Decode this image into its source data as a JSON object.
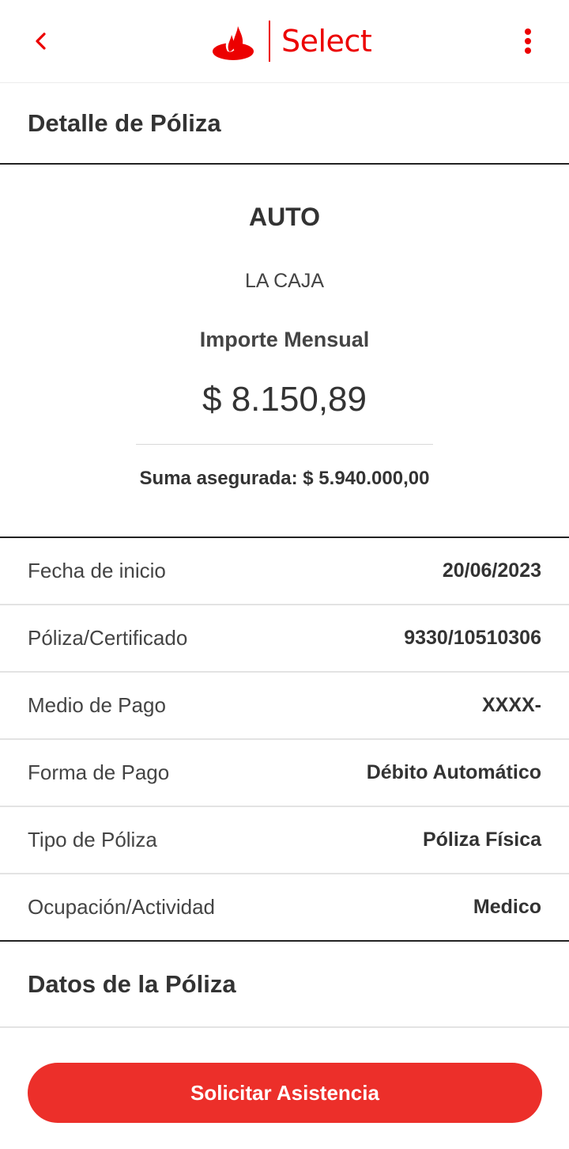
{
  "header": {
    "brand_text": "Select",
    "back_icon": "chevron-left-icon",
    "menu_icon": "kebab-menu-icon",
    "logo_icon": "santander-flame-icon",
    "accent_color": "#ec0000"
  },
  "page": {
    "title": "Detalle de Póliza"
  },
  "summary": {
    "type": "AUTO",
    "insurer": "LA CAJA",
    "amount_label": "Importe Mensual",
    "amount": "$ 8.150,89",
    "insured_sum": "Suma asegurada: $ 5.940.000,00"
  },
  "details": [
    {
      "label": "Fecha de inicio",
      "value": "20/06/2023"
    },
    {
      "label": "Póliza/Certificado",
      "value": "9330/10510306"
    },
    {
      "label": "Medio de Pago",
      "value": "XXXX-"
    },
    {
      "label": "Forma de Pago",
      "value": "Débito Automático"
    },
    {
      "label": "Tipo de Póliza",
      "value": "Póliza Física"
    },
    {
      "label": "Ocupación/Actividad",
      "value": "Medico"
    }
  ],
  "datos_section": {
    "title": "Datos de la Póliza"
  },
  "cta": {
    "label": "Solicitar Asistencia",
    "color": "#ec2f2a"
  }
}
